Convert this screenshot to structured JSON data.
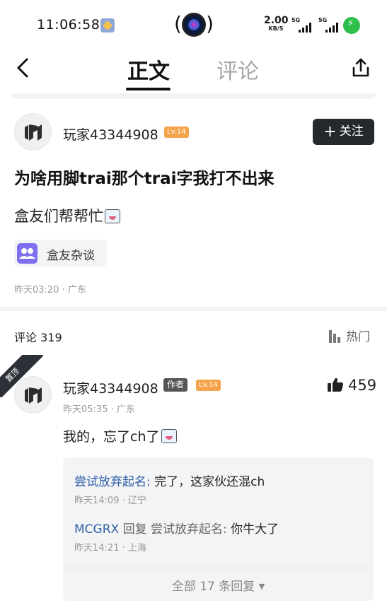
{
  "status_bar": {
    "time": "11:06:58",
    "speed_value": "2.00",
    "speed_unit": "KB/S",
    "sim1": "5G",
    "sim2": "5G"
  },
  "nav": {
    "tab_active": "正文",
    "tab_inactive": "评论"
  },
  "post": {
    "username": "玩家43344908",
    "level": "Lv.14",
    "follow_label": "关注",
    "title": "为啥用脚trai那个trai字我打不出来",
    "body": "盒友们帮帮忙",
    "topic": "盒友杂谈",
    "meta": "昨天03:20 · 广东"
  },
  "comments_header": {
    "count_label": "评论 319",
    "sort_label": "热门"
  },
  "comment": {
    "pin_label": "置顶",
    "username": "玩家43344908",
    "author_badge": "作者",
    "level": "Lv.14",
    "likes": "459",
    "meta": "昨天05:35 · 广东",
    "body": "我的，忘了ch了",
    "replies": [
      {
        "user": "尝试放弃起名",
        "text": "完了，这家伙还混ch",
        "time": "昨天14:09 · 辽宁"
      },
      {
        "user": "MCGRX",
        "reply_word": "回复",
        "target": "尝试放弃起名:",
        "text": "你牛大了",
        "time": "昨天14:21 · 上海"
      }
    ],
    "all_replies_label": "全部 17 条回复"
  }
}
